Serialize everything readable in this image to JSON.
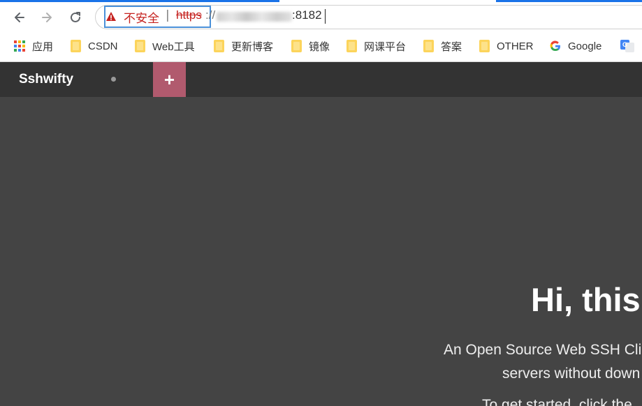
{
  "browser": {
    "security_label": "不安全",
    "separator": "|",
    "url_scheme": "https",
    "url_scheme_sep": "://",
    "url_port": ":8182"
  },
  "bookmarks": [
    {
      "label": "应用",
      "icon": "apps-grid-icon"
    },
    {
      "label": "CSDN",
      "icon": "folder-icon"
    },
    {
      "label": "Web工具",
      "icon": "folder-icon"
    },
    {
      "label": "更新博客",
      "icon": "folder-icon"
    },
    {
      "label": "镜像",
      "icon": "folder-icon"
    },
    {
      "label": "网课平台",
      "icon": "folder-icon"
    },
    {
      "label": "答案",
      "icon": "folder-icon"
    },
    {
      "label": "OTHER",
      "icon": "folder-icon"
    },
    {
      "label": "Google",
      "icon": "google-icon"
    }
  ],
  "app": {
    "brand": "Sshwifty",
    "add_tab": "+",
    "hero_title": "Hi, this",
    "hero_line1": "An Open Source Web SSH Clie",
    "hero_line2": "servers without down",
    "hero_line3": "To get started, click the"
  },
  "colors": {
    "accent": "#b15a6e",
    "app_bar": "#333333",
    "content_bg": "#444444",
    "insecure_red": "#c5221f"
  }
}
